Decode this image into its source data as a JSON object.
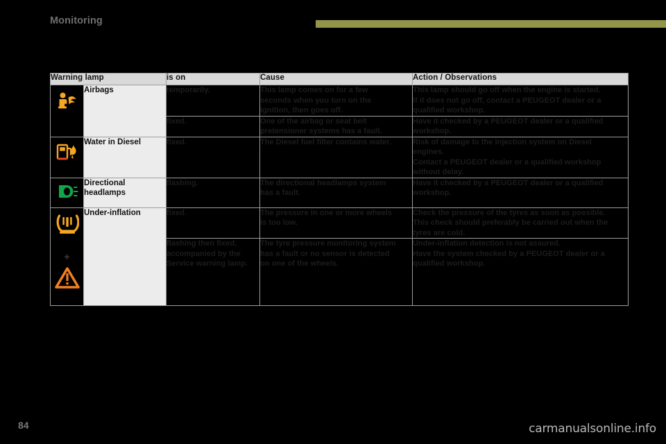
{
  "header": {
    "section_title": "Monitoring",
    "rule_color": "#939548"
  },
  "table": {
    "columns": [
      {
        "key": "lamp",
        "label": "Warning lamp"
      },
      {
        "key": "ison",
        "label": "is on"
      },
      {
        "key": "cause",
        "label": "Cause"
      },
      {
        "key": "action",
        "label": "Action / Observations"
      }
    ],
    "rows": [
      {
        "icon": "airbag-warning-icon",
        "icon_color": "#F5A623",
        "name": "Airbags",
        "is_on": [
          "temporarily."
        ],
        "cause": [
          "This lamp comes on for a few",
          "seconds when you turn on the",
          "ignition, then goes off."
        ],
        "action": [
          "This lamp should go off when the engine is started.",
          "If it does not go off, contact a PEUGEOT dealer or a",
          "qualified workshop."
        ]
      },
      {
        "icon": "",
        "name": "",
        "is_on": [
          "fixed."
        ],
        "cause": [
          "One of the airbag or seat belt",
          "pretensioner systems has a fault."
        ],
        "action": [
          "Have it checked by a PEUGEOT dealer or a qualified",
          "workshop."
        ]
      },
      {
        "icon": "water-in-diesel-icon",
        "icon_color": "#F5A623",
        "name": "Water in Diesel",
        "is_on": [
          "fixed."
        ],
        "cause": [
          "The Diesel fuel filter contains water."
        ],
        "action": [
          "Risk of damage to the injection system on Diesel",
          "engines.",
          "Contact a PEUGEOT dealer or a qualified workshop",
          "without delay."
        ]
      },
      {
        "icon": "directional-headlamps-icon",
        "icon_color": "#12A64A",
        "name": "Directional headlamps",
        "is_on": [
          "flashing."
        ],
        "cause": [
          "The directional headlamps system",
          "has a fault."
        ],
        "action": [
          "Have it checked by a PEUGEOT dealer or a qualified",
          "workshop."
        ]
      },
      {
        "icon": "under-inflation-tyre-icon",
        "icon_color": "#F5A623",
        "name": "Under-inflation",
        "is_on": [
          "fixed."
        ],
        "cause": [
          "The pressure in one or more wheels",
          "is too low."
        ],
        "action": [
          "Check the pressure of the tyres as soon as possible.",
          "This check should preferably be carried out when the",
          "tyres are cold."
        ]
      },
      {
        "icon": "service-warning-triangle-icon",
        "icon_color": "#F07F22",
        "icon_prefix": "+",
        "name": "",
        "is_on": [
          "flashing then fixed,",
          "accompanied by the",
          "Service warning lamp."
        ],
        "cause": [
          "The tyre pressure monitoring system",
          "has a fault or no sensor is detected",
          "on one of the wheels."
        ],
        "action": [
          "Under-inflation detection is not assured.",
          "Have the system checked by a PEUGEOT dealer or a",
          "qualified workshop."
        ]
      }
    ]
  },
  "footer": {
    "page_number": "84",
    "watermark": "carmanualsonline.info"
  }
}
